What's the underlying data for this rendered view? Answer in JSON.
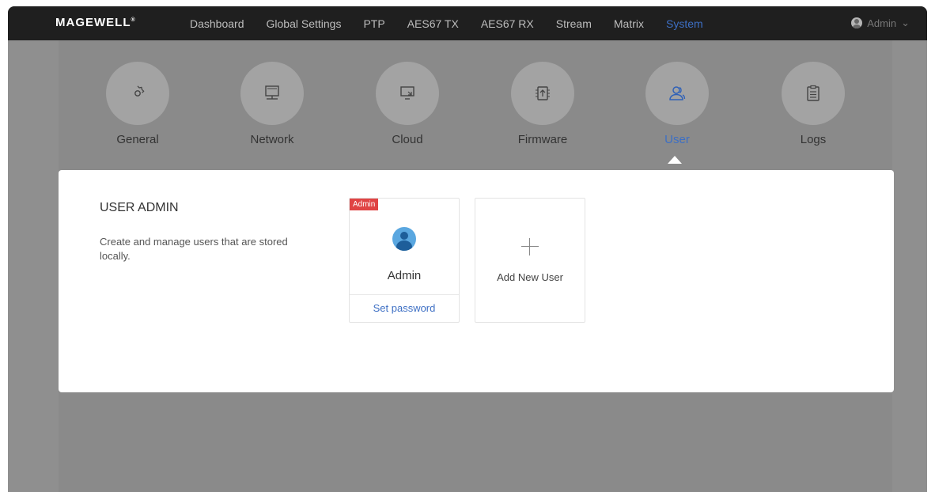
{
  "topbar": {
    "logo": "MAGEWELL",
    "logo_mark": "®",
    "nav": [
      {
        "label": "Dashboard",
        "active": false
      },
      {
        "label": "Global Settings",
        "active": false
      },
      {
        "label": "PTP",
        "active": false
      },
      {
        "label": "AES67 TX",
        "active": false
      },
      {
        "label": "AES67 RX",
        "active": false
      },
      {
        "label": "Stream",
        "active": false
      },
      {
        "label": "Matrix",
        "active": false
      },
      {
        "label": "System",
        "active": true
      }
    ],
    "account_label": "Admin",
    "account_chevron": "⌄"
  },
  "categories": [
    {
      "label": "General",
      "icon": "gear-icon"
    },
    {
      "label": "Network",
      "icon": "monitor-network-icon"
    },
    {
      "label": "Cloud",
      "icon": "screen-cast-icon"
    },
    {
      "label": "Firmware",
      "icon": "chip-upload-icon"
    },
    {
      "label": "User",
      "icon": "users-icon",
      "active": true
    },
    {
      "label": "Logs",
      "icon": "clipboard-icon"
    }
  ],
  "panel": {
    "title": "USER ADMIN",
    "description": "Create and manage users that are stored locally.",
    "users": [
      {
        "badge": "Admin",
        "name": "Admin",
        "action": "Set password"
      }
    ],
    "add_label": "Add New User"
  },
  "colors": {
    "accent": "#3d6fc4",
    "badge": "#e04444",
    "topbar": "#1f1f1f",
    "overlay": "#8f8f8f"
  }
}
